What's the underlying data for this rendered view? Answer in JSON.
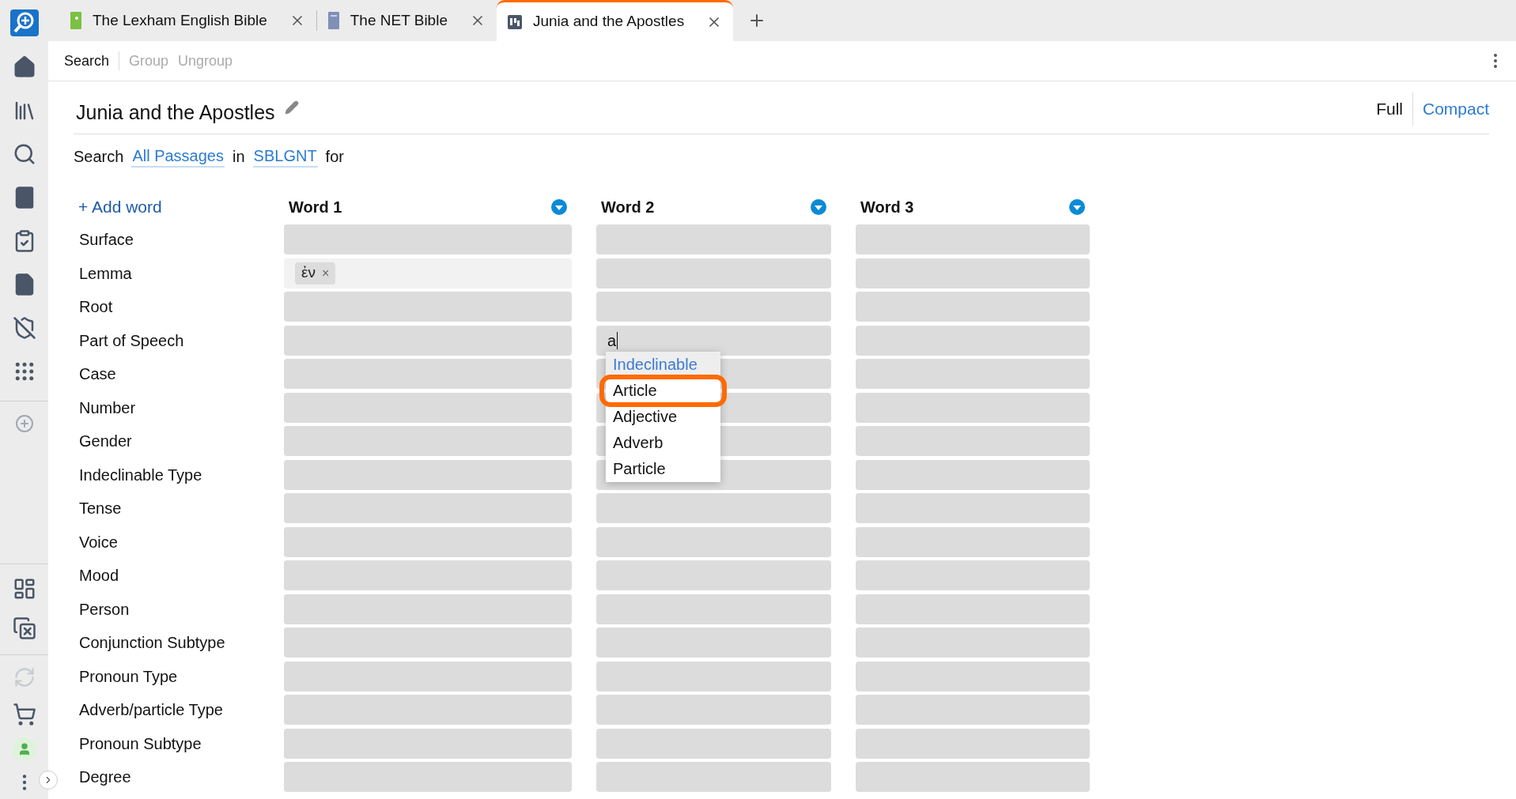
{
  "tabs": [
    {
      "label": "The Lexham English Bible",
      "selected": false
    },
    {
      "label": "The NET Bible",
      "selected": false
    },
    {
      "label": "Junia and the Apostles",
      "selected": true
    }
  ],
  "toolbar": [
    {
      "label": "Search",
      "disabled": false
    },
    {
      "label": "Group",
      "disabled": true
    },
    {
      "label": "Ungroup",
      "disabled": true
    }
  ],
  "title": "Junia and the Apostles",
  "views": [
    {
      "label": "Full",
      "selected": true
    },
    {
      "label": "Compact",
      "selected": false
    }
  ],
  "search_line": [
    {
      "kind": "text",
      "text": "Search"
    },
    {
      "kind": "link",
      "text": "All Passages"
    },
    {
      "kind": "text",
      "text": "in"
    },
    {
      "kind": "link",
      "text": "SBLGNT"
    },
    {
      "kind": "text",
      "text": "for"
    }
  ],
  "add_word": "+ Add word",
  "columns": [
    "Word 1",
    "Word 2",
    "Word 3"
  ],
  "rows": [
    {
      "label": "Surface",
      "cells": [
        {
          "kind": "empty"
        },
        {
          "kind": "empty"
        },
        {
          "kind": "empty"
        }
      ]
    },
    {
      "label": "Lemma",
      "cells": [
        {
          "kind": "token",
          "token": "ἐν",
          "remove": "×"
        },
        {
          "kind": "empty"
        },
        {
          "kind": "empty"
        }
      ]
    },
    {
      "label": "Root",
      "cells": [
        {
          "kind": "empty"
        },
        {
          "kind": "empty"
        },
        {
          "kind": "empty"
        }
      ]
    },
    {
      "label": "Part of Speech",
      "cells": [
        {
          "kind": "empty"
        },
        {
          "kind": "input",
          "value": "a",
          "suggestions": [
            {
              "label": "Indeclinable",
              "selected": true,
              "annotated": false
            },
            {
              "label": "Article",
              "selected": false,
              "annotated": true
            },
            {
              "label": "Adjective",
              "selected": false,
              "annotated": false
            },
            {
              "label": "Adverb",
              "selected": false,
              "annotated": false
            },
            {
              "label": "Particle",
              "selected": false,
              "annotated": false
            }
          ]
        },
        {
          "kind": "empty"
        }
      ]
    },
    {
      "label": "Case",
      "cells": [
        {
          "kind": "empty"
        },
        {
          "kind": "empty"
        },
        {
          "kind": "empty"
        }
      ]
    },
    {
      "label": "Number",
      "cells": [
        {
          "kind": "empty"
        },
        {
          "kind": "empty"
        },
        {
          "kind": "empty"
        }
      ]
    },
    {
      "label": "Gender",
      "cells": [
        {
          "kind": "empty"
        },
        {
          "kind": "empty"
        },
        {
          "kind": "empty"
        }
      ]
    },
    {
      "label": "Indeclinable Type",
      "cells": [
        {
          "kind": "empty"
        },
        {
          "kind": "empty"
        },
        {
          "kind": "empty"
        }
      ]
    },
    {
      "label": "Tense",
      "cells": [
        {
          "kind": "empty"
        },
        {
          "kind": "empty"
        },
        {
          "kind": "empty"
        }
      ]
    },
    {
      "label": "Voice",
      "cells": [
        {
          "kind": "empty"
        },
        {
          "kind": "empty"
        },
        {
          "kind": "empty"
        }
      ]
    },
    {
      "label": "Mood",
      "cells": [
        {
          "kind": "empty"
        },
        {
          "kind": "empty"
        },
        {
          "kind": "empty"
        }
      ]
    },
    {
      "label": "Person",
      "cells": [
        {
          "kind": "empty"
        },
        {
          "kind": "empty"
        },
        {
          "kind": "empty"
        }
      ]
    },
    {
      "label": "Conjunction Subtype",
      "cells": [
        {
          "kind": "empty"
        },
        {
          "kind": "empty"
        },
        {
          "kind": "empty"
        }
      ]
    },
    {
      "label": "Pronoun Type",
      "cells": [
        {
          "kind": "empty"
        },
        {
          "kind": "empty"
        },
        {
          "kind": "empty"
        }
      ]
    },
    {
      "label": "Adverb/particle Type",
      "cells": [
        {
          "kind": "empty"
        },
        {
          "kind": "empty"
        },
        {
          "kind": "empty"
        }
      ]
    },
    {
      "label": "Pronoun Subtype",
      "cells": [
        {
          "kind": "empty"
        },
        {
          "kind": "empty"
        },
        {
          "kind": "empty"
        }
      ]
    },
    {
      "label": "Degree",
      "cells": [
        {
          "kind": "empty"
        },
        {
          "kind": "empty"
        },
        {
          "kind": "empty"
        }
      ]
    }
  ]
}
